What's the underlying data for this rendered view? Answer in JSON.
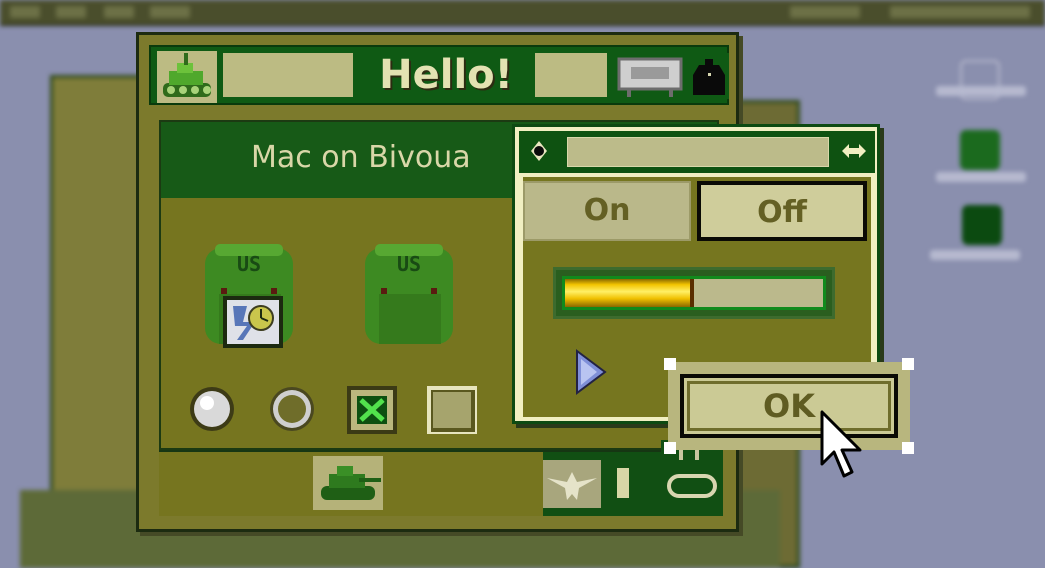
{
  "window": {
    "title": "Hello!",
    "content_title": "Mac on Bivoua"
  },
  "backpacks": [
    {
      "label": "US",
      "content_icon": "finder-clock-icon"
    },
    {
      "label": "US",
      "content_icon": "none"
    }
  ],
  "controls": {
    "radio_1_selected": true,
    "radio_2_selected": false,
    "checkbox_1_checked": true,
    "checkbox_2_checked": false
  },
  "footer": {
    "left_icon": "tank-icon",
    "right_icons": [
      "eagle-icon",
      "bar-icon",
      "tank-outline-icon"
    ]
  },
  "dialog": {
    "segment_on_label": "On",
    "segment_off_label": "Off",
    "selected_segment": "Off",
    "progress_fraction": 0.5,
    "ok_label": "OK"
  },
  "colors": {
    "window_olive": "#7c7a2c",
    "title_green": "#0f5a14",
    "dialog_cream": "#f1efc2",
    "progress_gold": "#f3c400"
  }
}
